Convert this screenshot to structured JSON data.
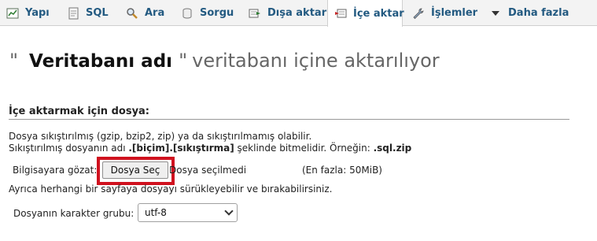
{
  "tabs": [
    {
      "label": "Yapı",
      "icon": "structure-icon"
    },
    {
      "label": "SQL",
      "icon": "sql-icon"
    },
    {
      "label": "Ara",
      "icon": "search-icon"
    },
    {
      "label": "Sorgu",
      "icon": "query-icon"
    },
    {
      "label": "Dışa aktar",
      "icon": "export-icon"
    },
    {
      "label": "İçe aktar",
      "icon": "import-icon",
      "active": true
    },
    {
      "label": "İşlemler",
      "icon": "wrench-icon"
    },
    {
      "label": "Daha fazla",
      "icon": "caret-down-icon"
    }
  ],
  "page_title": {
    "open_quote": "\"",
    "db_name": "Veritabanı adı",
    "close_quote": "\"",
    "rest": "veritabanı içine aktarılıyor"
  },
  "section": {
    "heading": "İçe aktarmak için dosya:",
    "desc_line1": "Dosya sıkıştırılmış (gzip, bzip2, zip) ya da sıkıştırılmamış olabilir.",
    "desc_line2_prefix": "Sıkıştırılmış dosyanın adı ",
    "desc_line2_bold": ".[biçim].[sıkıştırma]",
    "desc_line2_mid": " şeklinde bitmelidir. Örneğin: ",
    "desc_line2_example": ".sql.zip"
  },
  "file": {
    "browse_label": "Bilgisayara gözat:",
    "choose_button": "Dosya Seç",
    "no_file": "Dosya seçilmedi",
    "max_size": "(En fazla: 50MiB)"
  },
  "dragdrop_text": "Ayrıca herhangi bir sayfaya dosyayı sürükleyebilir ve bırakabilirsiniz.",
  "charset": {
    "label": "Dosyanın karakter grubu:",
    "value": "utf-8"
  },
  "colors": {
    "accent": "#235a81",
    "highlight": "#d0121f"
  }
}
